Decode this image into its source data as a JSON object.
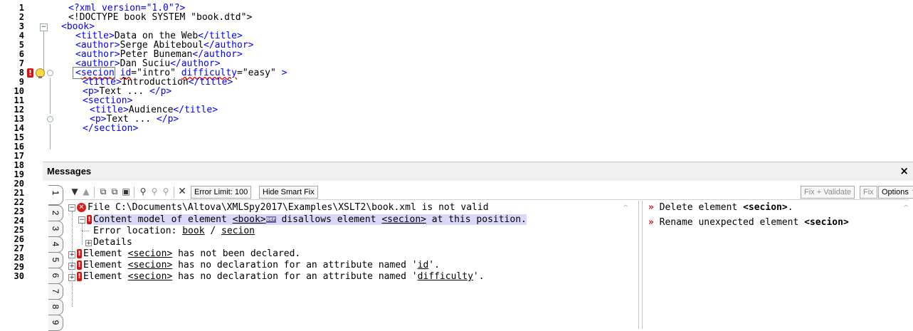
{
  "editor": {
    "line_numbers": [
      "1",
      "2",
      "3",
      "4",
      "5",
      "6",
      "7",
      "8",
      "9",
      "10",
      "11",
      "12",
      "13",
      "14",
      "15",
      "16",
      "17",
      "18",
      "19",
      "20",
      "21",
      "22",
      "23",
      "24",
      "25",
      "26",
      "27",
      "28",
      "29",
      "30"
    ],
    "lines": {
      "l1": "<?xml version=\"1.0\"?>",
      "l2": "<!DOCTYPE book SYSTEM \"book.dtd\">",
      "l3_open": "<book>",
      "l4_tag_o": "<title>",
      "l4_text": "Data on the Web",
      "l4_tag_c": "</title>",
      "l5_tag_o": "<author>",
      "l5_text": "Serge Abiteboul",
      "l5_tag_c": "</author>",
      "l6_tag_o": "<author>",
      "l6_text": "Peter Buneman",
      "l6_tag_c": "</author>",
      "l7_tag_o": "<author>",
      "l7_text": "Dan Suciu",
      "l7_tag_c": "</author>",
      "l8_lt": "<",
      "l8_name": "secion",
      "l8_attr1": "id",
      "l8_eq1": "=",
      "l8_val1": "\"intro\"",
      "l8_attr2": "difficulty",
      "l8_eq2": "=",
      "l8_val2": "\"easy\"",
      "l8_end": " >",
      "l9_tag_o": "<title>",
      "l9_text": "Introduction",
      "l9_tag_c": "</title>",
      "l10_tag_o": "<p>",
      "l10_text": "Text ... ",
      "l10_tag_c": "</p>",
      "l11": "<section>",
      "l12_tag_o": "<title>",
      "l12_text": "Audience",
      "l12_tag_c": "</title>",
      "l13_tag_o": "<p>",
      "l13_text": "Text ... ",
      "l13_tag_c": "</p>",
      "l14": "</section>"
    }
  },
  "messages": {
    "title": "Messages",
    "close_glyph": "×",
    "tabs": [
      "1",
      "2",
      "3",
      "4",
      "5",
      "6",
      "7",
      "8",
      "9"
    ],
    "toolbar": {
      "error_limit": "Error Limit: 100",
      "hide_smart_fix": "Hide Smart Fix",
      "fix_validate": "Fix + Validate",
      "fix": "Fix",
      "options": "Options"
    },
    "left": {
      "file_line": "File C:\\Documents\\Altova\\XMLSpy2017\\Examples\\XSLT2\\book.xml is not valid",
      "content_model_a": "Content model of element ",
      "content_model_el": "<book>",
      "content_model_b": " disallows element ",
      "content_model_el2": "<secion>",
      "content_model_c": " at this position.",
      "error_location_label": "Error location: ",
      "error_location_a": "book",
      "error_location_sep": " / ",
      "error_location_b": "secion",
      "details": "Details",
      "msg2_a": "Element ",
      "msg2_el": "<secion>",
      "msg2_b": " has not been declared.",
      "msg3_a": "Element ",
      "msg3_el": "<secion>",
      "msg3_b": " has no declaration for an attribute named '",
      "msg3_attr": "id",
      "msg3_c": "'.",
      "msg4_a": "Element ",
      "msg4_el": "<secion>",
      "msg4_b": " has no declaration for an attribute named '",
      "msg4_attr": "difficulty",
      "msg4_c": "'.",
      "def_badge": "DEF"
    },
    "right": {
      "fix1_a": "Delete element ",
      "fix1_el": "<secion>",
      "fix1_b": ".",
      "fix2_a": "Rename unexpected element ",
      "fix2_el": "<secion>"
    }
  },
  "colors": {
    "tag_blue": "#0000ff",
    "error_red": "#d81010",
    "highlight_row": "#d8d8f8"
  }
}
